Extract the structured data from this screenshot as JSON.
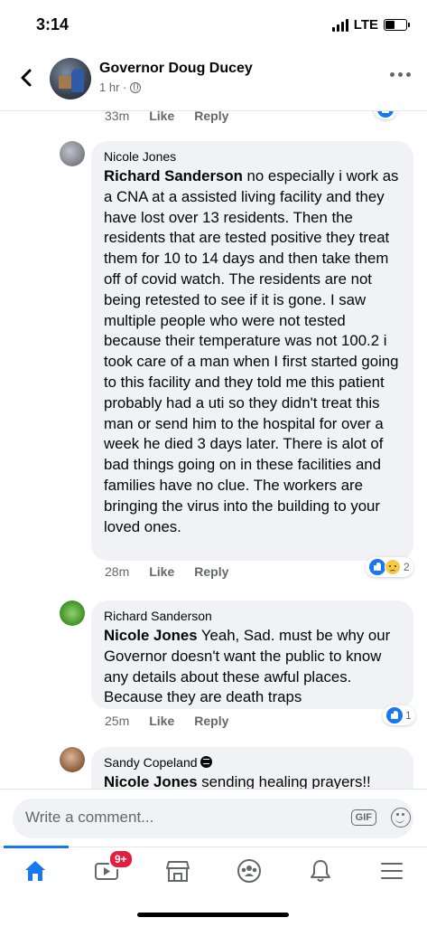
{
  "status": {
    "time": "3:14",
    "network": "LTE"
  },
  "header": {
    "name": "Governor Doug Ducey",
    "meta": "1 hr ·"
  },
  "prev_comment": {
    "time": "33m",
    "like": "Like",
    "reply": "Reply"
  },
  "comments": [
    {
      "author": "Nicole Jones",
      "mention": "Richard Sanderson",
      "text": " no especially i work as a CNA at a assisted living facility and they have lost over 13 residents.  Then the residents that are tested positive they treat them for 10 to 14 days and then take them off of covid watch. The residents are not being retested to see if it is gone. I saw multiple people who were not tested because their temperature was not 100.2  i took care of a man when I first started going to this facility and they told me this patient probably had a uti so they didn't treat this man or send him to the hospital for over a week he died 3 days later. There is alot of bad things going on in these facilities and families have no clue. The workers are bringing the virus into the building to your loved ones.",
      "time": "28m",
      "like": "Like",
      "reply": "Reply",
      "reactions": "2"
    },
    {
      "author": "Richard Sanderson",
      "mention": "Nicole Jones",
      "text": " Yeah, Sad. must be why our Governor doesn't want the public to know any details about these awful places. Because they are death traps",
      "time": "25m",
      "like": "Like",
      "reply": "Reply",
      "reactions": "1"
    },
    {
      "author": "Sandy Copeland",
      "mention": "Nicole Jones",
      "text": " sending healing prayers!!"
    }
  ],
  "composer": {
    "placeholder": "Write a comment...",
    "gif": "GIF"
  },
  "tabbar": {
    "video_badge": "9+"
  },
  "colors": {
    "accent": "#1877f2",
    "bubble": "#f0f2f5",
    "badge": "#e41e3f"
  }
}
